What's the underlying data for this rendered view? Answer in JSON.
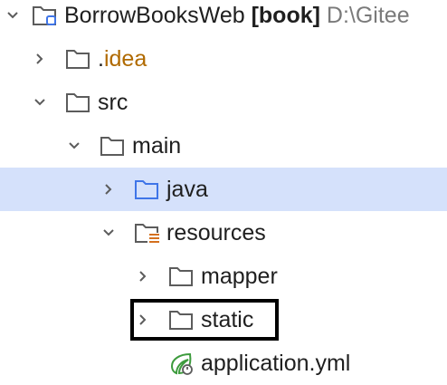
{
  "project_tree": {
    "root": {
      "name": "BorrowBooksWeb",
      "module": "[book]",
      "path": "D:\\Gitee"
    },
    "idea": "idea",
    "idea_prefix": ".",
    "src": "src",
    "main": "main",
    "java": "java",
    "resources": "resources",
    "mapper": "mapper",
    "static": "static",
    "application_yml": "application.yml"
  },
  "colors": {
    "selected_row_bg": "#d5e1fb",
    "folder_stroke": "#5c5c5c",
    "java_folder_stroke": "#3f75e8",
    "resources_accent": "#d4701e",
    "spring_green": "#3d9b3d",
    "highlight_border": "#000000"
  }
}
